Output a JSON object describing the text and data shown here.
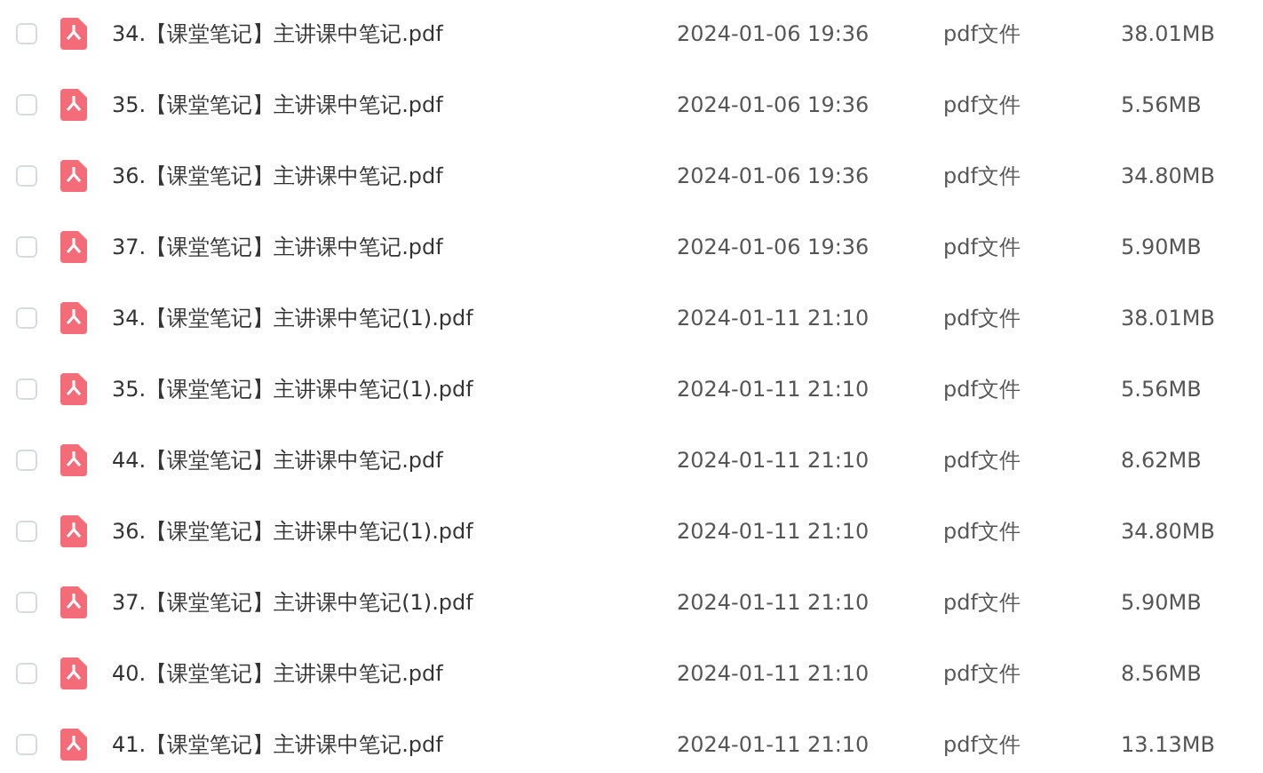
{
  "files": [
    {
      "name": "34.【课堂笔记】主讲课中笔记.pdf",
      "date": "2024-01-06 19:36",
      "type": "pdf文件",
      "size": "38.01MB",
      "checked": false
    },
    {
      "name": "35.【课堂笔记】主讲课中笔记.pdf",
      "date": "2024-01-06 19:36",
      "type": "pdf文件",
      "size": "5.56MB",
      "checked": false
    },
    {
      "name": "36.【课堂笔记】主讲课中笔记.pdf",
      "date": "2024-01-06 19:36",
      "type": "pdf文件",
      "size": "34.80MB",
      "checked": false
    },
    {
      "name": "37.【课堂笔记】主讲课中笔记.pdf",
      "date": "2024-01-06 19:36",
      "type": "pdf文件",
      "size": "5.90MB",
      "checked": false
    },
    {
      "name": "34.【课堂笔记】主讲课中笔记(1).pdf",
      "date": "2024-01-11 21:10",
      "type": "pdf文件",
      "size": "38.01MB",
      "checked": false
    },
    {
      "name": "35.【课堂笔记】主讲课中笔记(1).pdf",
      "date": "2024-01-11 21:10",
      "type": "pdf文件",
      "size": "5.56MB",
      "checked": false
    },
    {
      "name": "44.【课堂笔记】主讲课中笔记.pdf",
      "date": "2024-01-11 21:10",
      "type": "pdf文件",
      "size": "8.62MB",
      "checked": false
    },
    {
      "name": "36.【课堂笔记】主讲课中笔记(1).pdf",
      "date": "2024-01-11 21:10",
      "type": "pdf文件",
      "size": "34.80MB",
      "checked": false
    },
    {
      "name": "37.【课堂笔记】主讲课中笔记(1).pdf",
      "date": "2024-01-11 21:10",
      "type": "pdf文件",
      "size": "5.90MB",
      "checked": false
    },
    {
      "name": "40.【课堂笔记】主讲课中笔记.pdf",
      "date": "2024-01-11 21:10",
      "type": "pdf文件",
      "size": "8.56MB",
      "checked": false
    },
    {
      "name": "41.【课堂笔记】主讲课中笔记.pdf",
      "date": "2024-01-11 21:10",
      "type": "pdf文件",
      "size": "13.13MB",
      "checked": false
    }
  ]
}
